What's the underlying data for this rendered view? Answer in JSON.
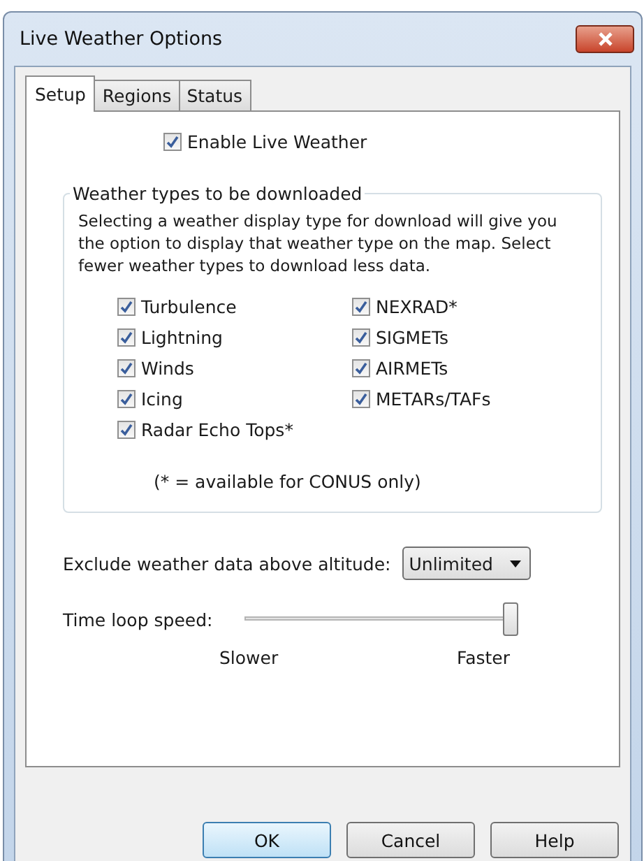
{
  "window": {
    "title": "Live Weather Options"
  },
  "tabs": [
    {
      "label": "Setup",
      "selected": true
    },
    {
      "label": "Regions",
      "selected": false
    },
    {
      "label": "Status",
      "selected": false
    }
  ],
  "enable_live_weather": {
    "label": "Enable Live Weather",
    "checked": true
  },
  "weather_types": {
    "title": "Weather types to be downloaded",
    "description": "Selecting a weather display type for download will give you the option to display that weather type on the map. Select fewer weather types to download less data.",
    "left": [
      {
        "label": "Turbulence",
        "checked": true
      },
      {
        "label": "Lightning",
        "checked": true
      },
      {
        "label": "Winds",
        "checked": true
      },
      {
        "label": "Icing",
        "checked": true
      },
      {
        "label": "Radar Echo Tops*",
        "checked": true
      }
    ],
    "right": [
      {
        "label": "NEXRAD*",
        "checked": true
      },
      {
        "label": "SIGMETs",
        "checked": true
      },
      {
        "label": "AIRMETs",
        "checked": true
      },
      {
        "label": "METARs/TAFs",
        "checked": true
      }
    ],
    "footnote": "(* = available for CONUS only)"
  },
  "altitude": {
    "label": "Exclude weather data above altitude:",
    "value": "Unlimited"
  },
  "time_loop_speed": {
    "label": "Time loop speed:",
    "level": 1,
    "min_label": "Slower",
    "max_label": "Faster"
  },
  "buttons": [
    {
      "label": "OK",
      "default": true
    },
    {
      "label": "Cancel",
      "default": false
    },
    {
      "label": "Help",
      "default": false
    }
  ]
}
